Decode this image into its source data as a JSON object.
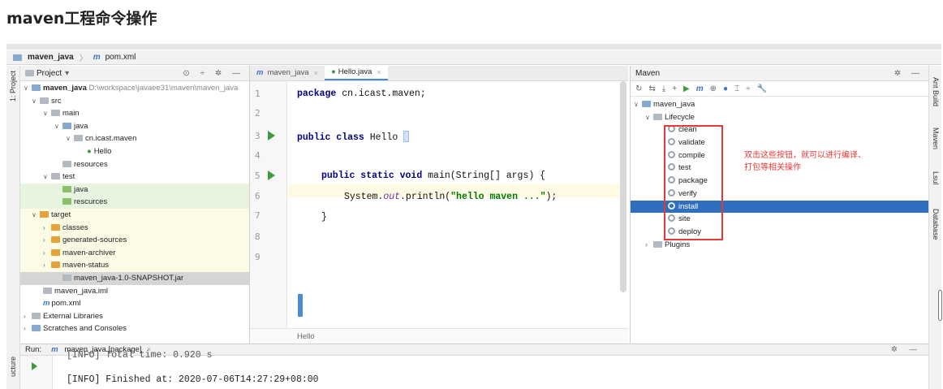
{
  "page": {
    "heading": "maven工程命令操作"
  },
  "nav": {
    "project": "maven_java",
    "file": "pom.xml"
  },
  "left_strip": {
    "project_tab": "1: Project",
    "structure_tab": "ucture"
  },
  "project_panel": {
    "header": "Project",
    "header_icons": "⊙ ÷ ✲ —",
    "tree": [
      {
        "label": "maven_java",
        "hint": "D:\\workspace\\javaee31\\maven\\maven_java",
        "bold": true
      },
      {
        "label": "src"
      },
      {
        "label": "main"
      },
      {
        "label": "java"
      },
      {
        "label": "cn.icast.maven"
      },
      {
        "label": "Hello"
      },
      {
        "label": "resources"
      },
      {
        "label": "test"
      },
      {
        "label": "java"
      },
      {
        "label": "rescurces"
      },
      {
        "label": "target"
      },
      {
        "label": "classes"
      },
      {
        "label": "generated-sources"
      },
      {
        "label": "maven-archiver"
      },
      {
        "label": "maven-status"
      },
      {
        "label": "maven_java-1.0-SNAPSHOT.jar"
      },
      {
        "label": "maven_java.iml"
      },
      {
        "label": "pom.xml"
      },
      {
        "label": "External Libraries"
      },
      {
        "label": "Scratches and Consoles"
      }
    ]
  },
  "editor": {
    "tabs": [
      {
        "label": "maven_java",
        "active": false
      },
      {
        "label": "Hello.java",
        "active": true
      }
    ],
    "line_numbers": [
      "1",
      "2",
      "3",
      "4",
      "5",
      "6",
      "7",
      "8",
      "9"
    ],
    "code": {
      "l1_kw": "package",
      "l1_rest": " cn.icast.maven;",
      "l3_kw": "public class",
      "l3_rest": " Hello ",
      "l5_kw": "public static void",
      "l5_rest": " main(String[] args) {",
      "l6_pre": "System.",
      "l6_it": "out",
      "l6_mid": ".println(",
      "l6_str": "\"hello maven ...\"",
      "l6_end": ");",
      "l7": "}"
    },
    "breadcrumb": "Hello"
  },
  "maven_panel": {
    "title": "Maven",
    "title_icons": "✲ —",
    "toolbar": [
      "↻",
      "⇆",
      "⤓",
      "+",
      "▶",
      "m",
      "⊕",
      "●",
      "⌶",
      "÷",
      "🔧"
    ],
    "root": "maven_java",
    "lifecycle": "Lifecycle",
    "goals": [
      "clean",
      "validate",
      "compile",
      "test",
      "package",
      "verify",
      "install",
      "site",
      "deploy"
    ],
    "selected_goal": "install",
    "plugins": "Plugins",
    "annotation": "双击这些按钮，就可以进行编译、打包等相关操作"
  },
  "right_strip": {
    "tabs": [
      "Ant Build",
      "Maven",
      "Lsul",
      "Database"
    ]
  },
  "run": {
    "label": "Run:",
    "config": "maven_java [package]",
    "icons": "✲ —",
    "lines": [
      "[INFO] Total time: 0.920 s",
      "[INFO] Finished at: 2020-07-06T14:27:29+08:00"
    ]
  }
}
